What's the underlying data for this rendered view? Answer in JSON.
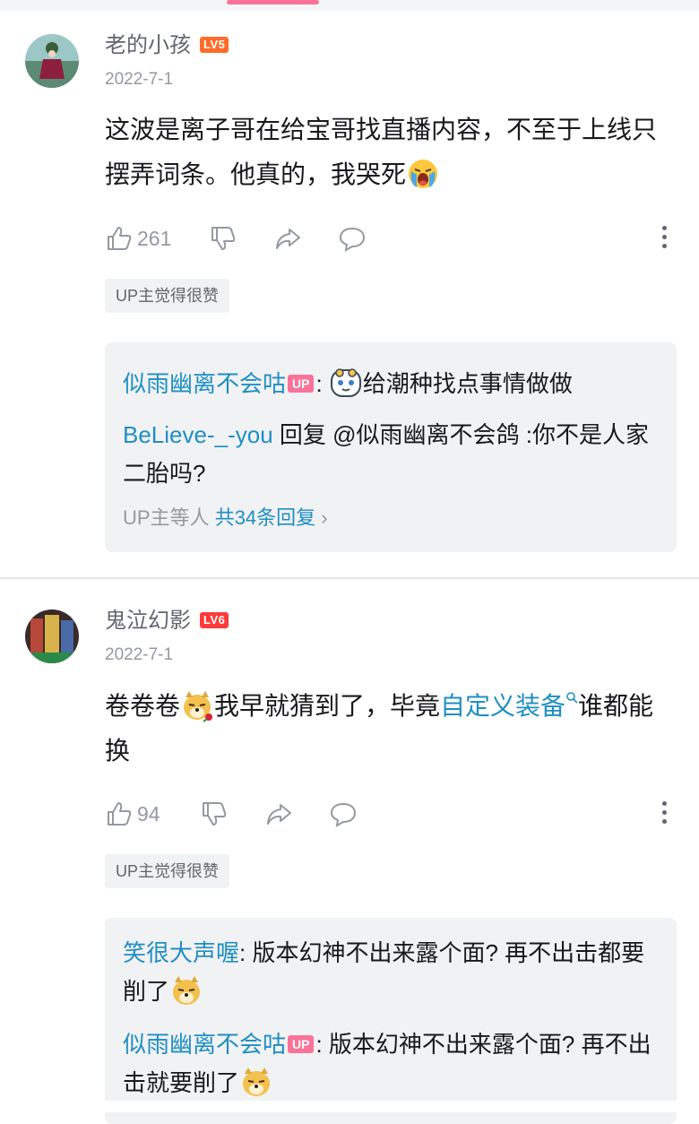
{
  "comments": [
    {
      "username": "老的小孩",
      "level": "LV5",
      "level_color": "#ff6b28",
      "date": "2022-7-1",
      "text_before": "这波是离子哥在给宝哥找直播内容，不至于上线只摆弄词条。他真的，我哭死",
      "emoji": "crying-face-icon",
      "likes": "261",
      "up_liked": "UP主觉得很赞",
      "replies": [
        {
          "name": "似雨幽离不会咕",
          "tag": "UP",
          "sep": ": ",
          "text": "给潮种找点事情做做"
        },
        {
          "name": "BeLieve-_-you",
          "text": " 回复 @似雨幽离不会鸽 :你不是人家二胎吗?"
        }
      ],
      "more_prefix": "UP主等人 ",
      "more_count": "共34条回复",
      "more_arrow": "›"
    },
    {
      "username": "鬼泣幻影",
      "level": "LV6",
      "level_color": "#ff3a3a",
      "date": "2022-7-1",
      "text_before": "卷卷卷",
      "text_mid": "我早就猜到了，毕竟",
      "link_text": "自定义装备",
      "text_after": "谁都能换",
      "likes": "94",
      "up_liked": "UP主觉得很赞",
      "replies": [
        {
          "name": "笑很大声喔",
          "sep": ": ",
          "text": "版本幻神不出来露个面? 再不出击都要削了"
        },
        {
          "name": "似雨幽离不会咕",
          "tag": "UP",
          "sep": ": ",
          "text": "版本幻神不出来露个面? 再不出击就要削了"
        }
      ]
    }
  ]
}
